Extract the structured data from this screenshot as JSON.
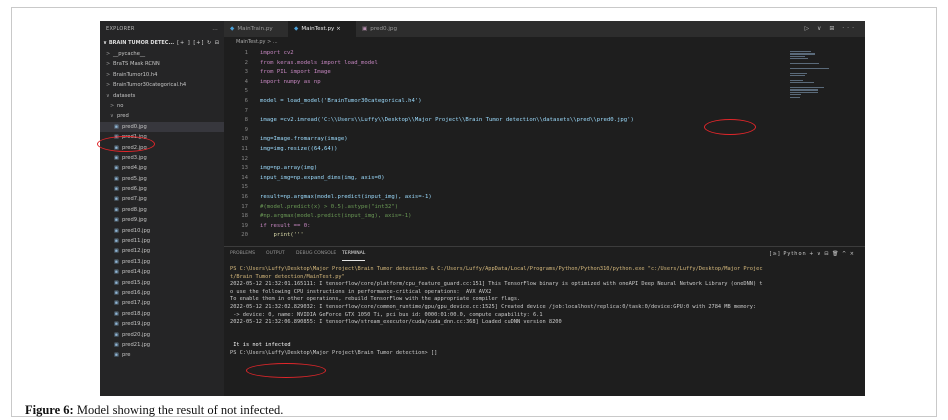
{
  "sidebar": {
    "header": "EXPLORER",
    "menu_dots": "...",
    "section": "BRAIN TUMOR DETEC...",
    "section_actions": "[+ ] [+] ↻ ⊟",
    "items": [
      {
        "chev": ">",
        "label": "__pycache__",
        "indent": 6,
        "file": false
      },
      {
        "chev": ">",
        "label": "BraTS Mask RCNN",
        "indent": 6,
        "file": false
      },
      {
        "chev": ">",
        "label": "BrainTumor10.h4",
        "indent": 6,
        "file": false
      },
      {
        "chev": ">",
        "label": "BrainTumor30categorical.h4",
        "indent": 6,
        "file": false
      },
      {
        "chev": "∨",
        "label": "datasets",
        "indent": 6,
        "file": false
      },
      {
        "chev": ">",
        "label": "no",
        "indent": 10,
        "file": false
      },
      {
        "chev": "∨",
        "label": "pred",
        "indent": 10,
        "file": false
      },
      {
        "chev": "",
        "label": "pred0.jpg",
        "indent": 14,
        "file": true,
        "selected": true
      },
      {
        "chev": "",
        "label": "pred1.jpg",
        "indent": 14,
        "file": true
      },
      {
        "chev": "",
        "label": "pred2.jpg",
        "indent": 14,
        "file": true
      },
      {
        "chev": "",
        "label": "pred3.jpg",
        "indent": 14,
        "file": true
      },
      {
        "chev": "",
        "label": "pred4.jpg",
        "indent": 14,
        "file": true
      },
      {
        "chev": "",
        "label": "pred5.jpg",
        "indent": 14,
        "file": true
      },
      {
        "chev": "",
        "label": "pred6.jpg",
        "indent": 14,
        "file": true
      },
      {
        "chev": "",
        "label": "pred7.jpg",
        "indent": 14,
        "file": true
      },
      {
        "chev": "",
        "label": "pred8.jpg",
        "indent": 14,
        "file": true
      },
      {
        "chev": "",
        "label": "pred9.jpg",
        "indent": 14,
        "file": true
      },
      {
        "chev": "",
        "label": "pred10.jpg",
        "indent": 14,
        "file": true
      },
      {
        "chev": "",
        "label": "pred11.jpg",
        "indent": 14,
        "file": true
      },
      {
        "chev": "",
        "label": "pred12.jpg",
        "indent": 14,
        "file": true
      },
      {
        "chev": "",
        "label": "pred13.jpg",
        "indent": 14,
        "file": true
      },
      {
        "chev": "",
        "label": "pred14.jpg",
        "indent": 14,
        "file": true
      },
      {
        "chev": "",
        "label": "pred15.jpg",
        "indent": 14,
        "file": true
      },
      {
        "chev": "",
        "label": "pred16.jpg",
        "indent": 14,
        "file": true
      },
      {
        "chev": "",
        "label": "pred17.jpg",
        "indent": 14,
        "file": true
      },
      {
        "chev": "",
        "label": "pred18.jpg",
        "indent": 14,
        "file": true
      },
      {
        "chev": "",
        "label": "pred19.jpg",
        "indent": 14,
        "file": true
      },
      {
        "chev": "",
        "label": "pred20.jpg",
        "indent": 14,
        "file": true
      },
      {
        "chev": "",
        "label": "pred21.jpg",
        "indent": 14,
        "file": true
      },
      {
        "chev": "",
        "label": "pre",
        "indent": 14,
        "file": true
      }
    ]
  },
  "tabs": [
    {
      "label": "MainTrain.py",
      "active": false,
      "close": ""
    },
    {
      "label": "MainTest.py",
      "active": true,
      "close": "×"
    },
    {
      "label": "pred0.jpg",
      "active": false,
      "close": ""
    }
  ],
  "tab_actions": "▷ ∨ ⊞ ···",
  "breadcrumb": "MainTest.py > ...",
  "code": [
    {
      "n": "1",
      "t": "import cv2"
    },
    {
      "n": "2",
      "t": "from keras.models import load_model"
    },
    {
      "n": "3",
      "t": "from PIL import Image"
    },
    {
      "n": "4",
      "t": "import numpy as np"
    },
    {
      "n": "5",
      "t": ""
    },
    {
      "n": "6",
      "t": "model = load_model('BrainTumor30categorical.h4')"
    },
    {
      "n": "7",
      "t": ""
    },
    {
      "n": "8",
      "t": "image =cv2.imread('C:\\\\Users\\\\Luffy\\\\Desktop\\\\Major Project\\\\Brain Tumor detection\\\\datasets\\\\pred\\\\pred0.jpg')"
    },
    {
      "n": "9",
      "t": ""
    },
    {
      "n": "10",
      "t": "img=Image.fromarray(image)"
    },
    {
      "n": "11",
      "t": "img=img.resize((64,64))"
    },
    {
      "n": "12",
      "t": ""
    },
    {
      "n": "13",
      "t": "img=np.array(img)"
    },
    {
      "n": "14",
      "t": "input_img=np.expand_dims(img, axis=0)"
    },
    {
      "n": "15",
      "t": ""
    },
    {
      "n": "16",
      "t": "result=np.argmax(model.predict(input_img), axis=-1)"
    },
    {
      "n": "17",
      "t": "#(model.predict(x) > 0.5).astype(\"int32\")"
    },
    {
      "n": "18",
      "t": "#np.argmax(model.predict(input_img), axis=-1)"
    },
    {
      "n": "19",
      "t": "if result == 0:"
    },
    {
      "n": "20",
      "t": "    print('''"
    }
  ],
  "panel": {
    "tabs": [
      "PROBLEMS",
      "OUTPUT",
      "DEBUG CONSOLE",
      "TERMINAL"
    ],
    "active_tab": "TERMINAL",
    "actions": "[≥] Python  +  ∨  ⊟  🗑  ^  ×"
  },
  "terminal": [
    "PS C:\\Users\\Luffy\\Desktop\\Major Project\\Brain Tumor detection> & C:/Users/Luffy/AppData/Local/Programs/Python/Python310/python.exe \"c:/Users/Luffy/Desktop/Major Projec",
    "t/Brain Tumor detection/MainTest.py\"",
    "2022-05-12 21:32:01.165111: I tensorflow/core/platform/cpu_feature_guard.cc:151] This TensorFlow binary is optimized with oneAPI Deep Neural Network Library (oneDNN) t",
    "o use the following CPU instructions in performance-critical operations:  AVX AVX2",
    "To enable them in other operations, rebuild TensorFlow with the appropriate compiler flags.",
    "2022-05-12 21:32:02.829032: I tensorflow/core/common_runtime/gpu/gpu_device.cc:1525] Created device /job:localhost/replica:0/task:0/device:GPU:0 with 2784 MB memory:",
    " -> device: 0, name: NVIDIA GeForce GTX 1050 Ti, pci bus id: 0000:01:00.0, compute capability: 6.1",
    "2022-05-12 21:32:06.890855: I tensorflow/stream_executor/cuda/cuda_dnn.cc:368] Loaded cuDNN version 8200",
    "",
    "",
    " It is not infected",
    "PS C:\\Users\\Luffy\\Desktop\\Major Project\\Brain Tumor detection> []"
  ],
  "caption": {
    "label": "Figure 6:",
    "text": " Model showing the result of not infected."
  }
}
